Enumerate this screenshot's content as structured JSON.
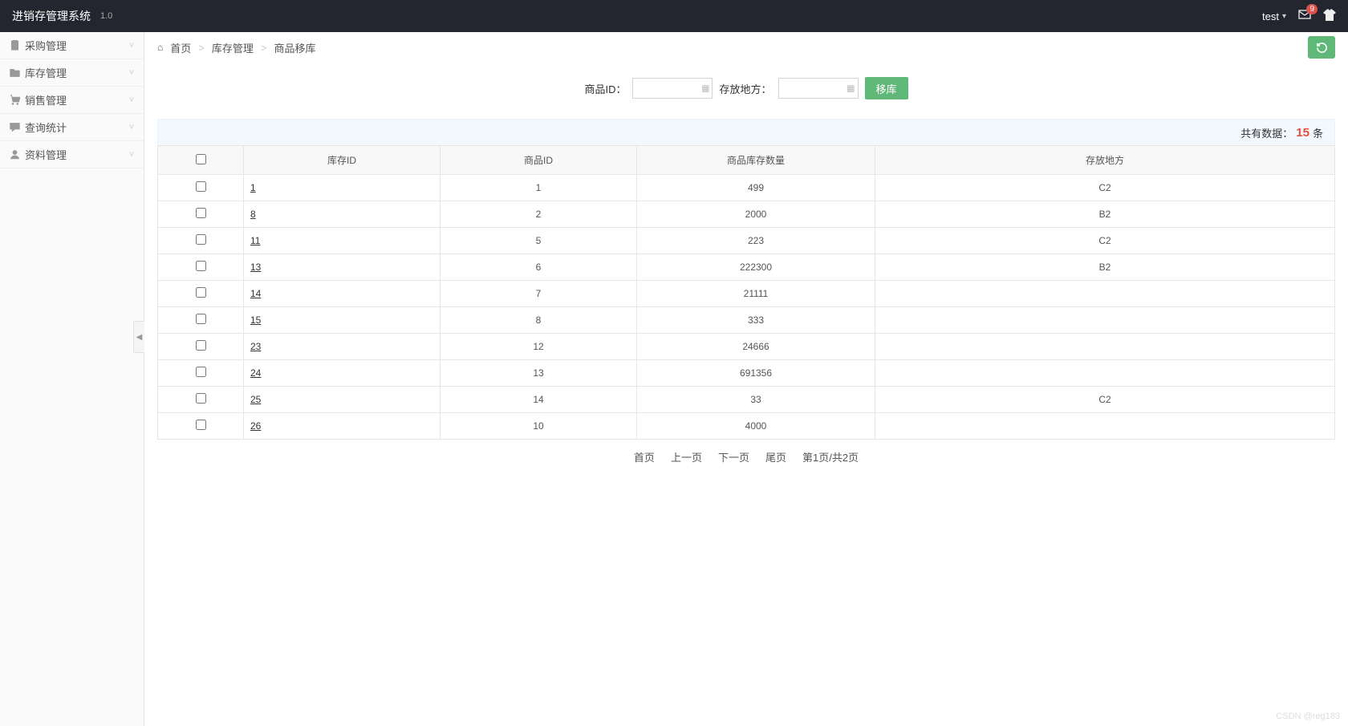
{
  "header": {
    "title": "进销存管理系统",
    "version": "1.0",
    "user": "test",
    "badge": "9"
  },
  "sidebar": {
    "items": [
      {
        "label": "采购管理",
        "icon": "clipboard"
      },
      {
        "label": "库存管理",
        "icon": "folder"
      },
      {
        "label": "销售管理",
        "icon": "cart"
      },
      {
        "label": "查询统计",
        "icon": "chat"
      },
      {
        "label": "资料管理",
        "icon": "user"
      }
    ]
  },
  "breadcrumb": {
    "home": "首页",
    "level1": "库存管理",
    "level2": "商品移库"
  },
  "filter": {
    "product_label": "商品ID：",
    "location_label": "存放地方：",
    "button": "移库"
  },
  "summary": {
    "prefix": "共有数据：",
    "count": "15",
    "suffix": "条"
  },
  "table": {
    "headers": [
      "库存ID",
      "商品ID",
      "商品库存数量",
      "存放地方"
    ],
    "rows": [
      {
        "stock_id": "1",
        "product_id": "1",
        "qty": "499",
        "loc": "C2"
      },
      {
        "stock_id": "8",
        "product_id": "2",
        "qty": "2000",
        "loc": "B2"
      },
      {
        "stock_id": "11",
        "product_id": "5",
        "qty": "223",
        "loc": "C2"
      },
      {
        "stock_id": "13",
        "product_id": "6",
        "qty": "222300",
        "loc": "B2"
      },
      {
        "stock_id": "14",
        "product_id": "7",
        "qty": "21111",
        "loc": ""
      },
      {
        "stock_id": "15",
        "product_id": "8",
        "qty": "333",
        "loc": ""
      },
      {
        "stock_id": "23",
        "product_id": "12",
        "qty": "24666",
        "loc": ""
      },
      {
        "stock_id": "24",
        "product_id": "13",
        "qty": "691356",
        "loc": ""
      },
      {
        "stock_id": "25",
        "product_id": "14",
        "qty": "33",
        "loc": "C2"
      },
      {
        "stock_id": "26",
        "product_id": "10",
        "qty": "4000",
        "loc": ""
      }
    ]
  },
  "pager": {
    "first": "首页",
    "prev": "上一页",
    "next": "下一页",
    "last": "尾页",
    "info": "第1页/共2页"
  },
  "watermark": "CSDN @reg183"
}
